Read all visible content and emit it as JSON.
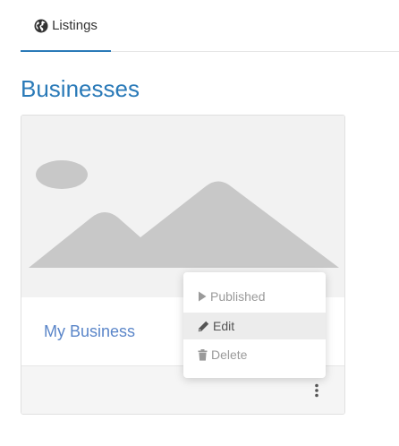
{
  "tabs": [
    {
      "label": "Listings",
      "icon": "globe-icon",
      "active": true
    }
  ],
  "page": {
    "title": "Businesses"
  },
  "card": {
    "image": "image-placeholder",
    "title": "My Business",
    "menu": {
      "items": [
        {
          "label": "Published",
          "icon": "play-icon",
          "state": "disabled"
        },
        {
          "label": "Edit",
          "icon": "pencil-icon",
          "state": "hover"
        },
        {
          "label": "Delete",
          "icon": "trash-icon",
          "state": "disabled"
        }
      ]
    }
  },
  "colors": {
    "accent": "#2a7ab8",
    "card_title": "#5b86c9"
  }
}
